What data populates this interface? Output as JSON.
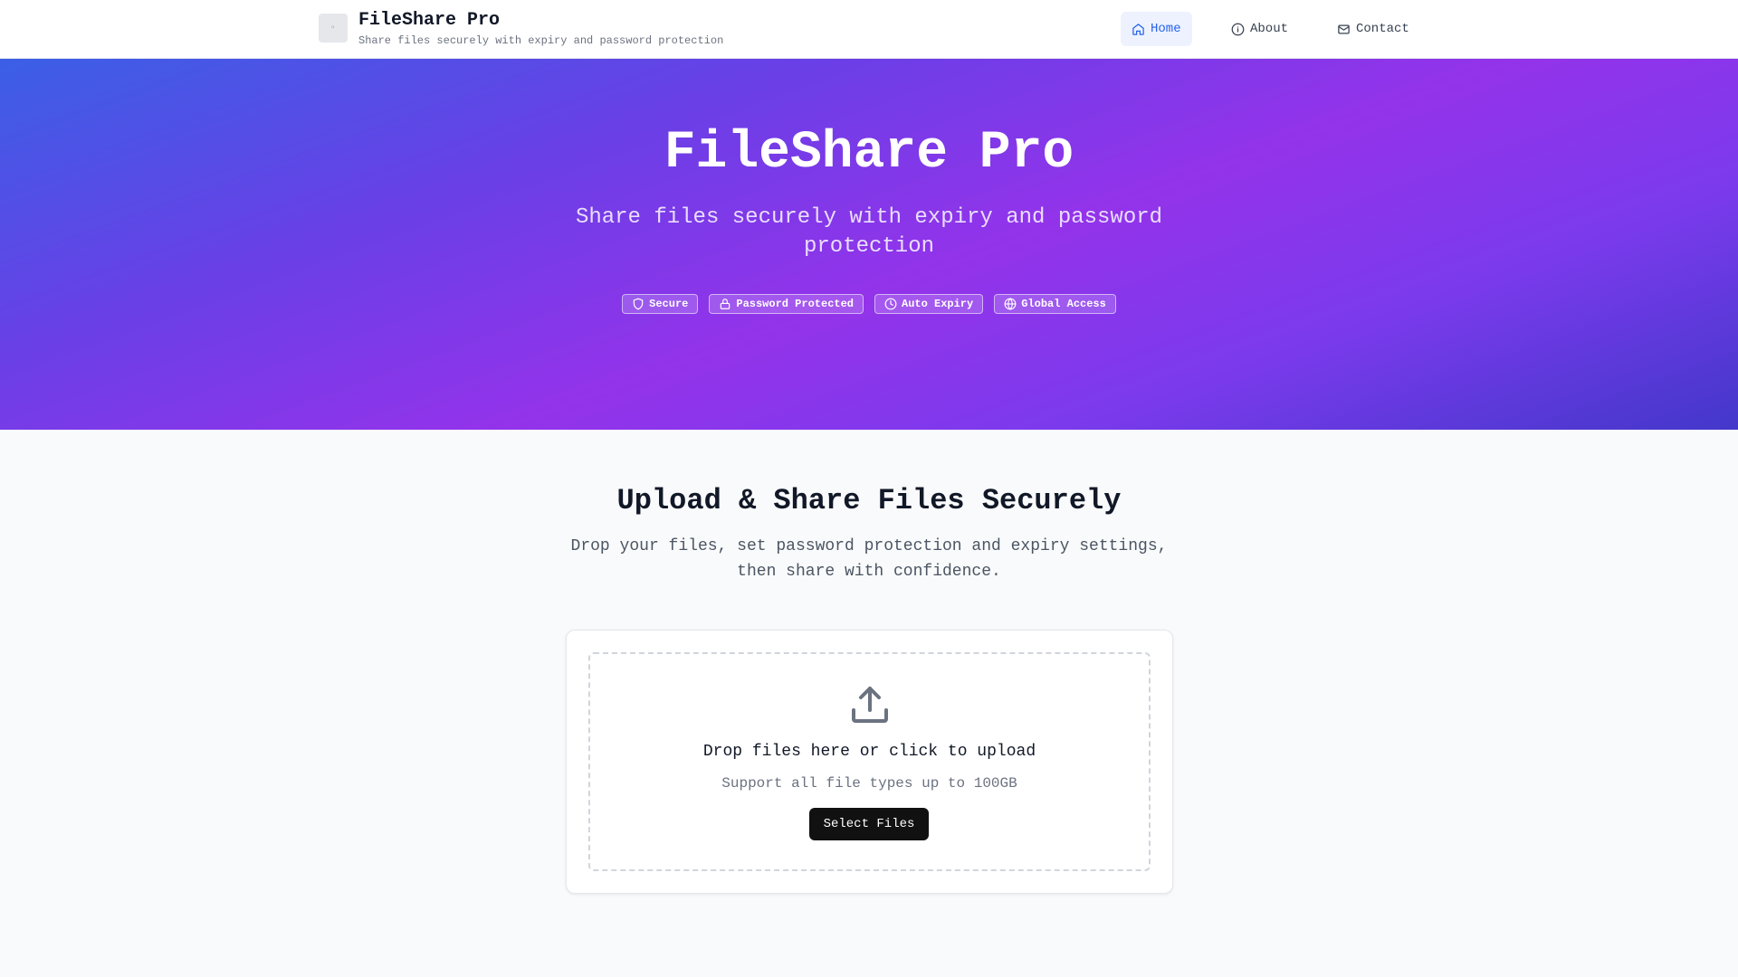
{
  "header": {
    "title": "FileShare Pro",
    "subtitle": "Share files securely with expiry and password protection",
    "nav": [
      {
        "label": "Home",
        "icon": "home-icon",
        "active": true
      },
      {
        "label": "About",
        "icon": "info-icon",
        "active": false
      },
      {
        "label": "Contact",
        "icon": "mail-icon",
        "active": false
      }
    ]
  },
  "hero": {
    "title": "FileShare Pro",
    "subtitle": "Share files securely with expiry and password protection",
    "badges": [
      {
        "label": "Secure",
        "icon": "shield-icon"
      },
      {
        "label": "Password Protected",
        "icon": "lock-icon"
      },
      {
        "label": "Auto Expiry",
        "icon": "clock-icon"
      },
      {
        "label": "Global Access",
        "icon": "globe-icon"
      }
    ]
  },
  "main": {
    "title": "Upload & Share Files Securely",
    "description": "Drop your files, set password protection and expiry settings, then share with confidence.",
    "upload": {
      "icon": "upload-icon",
      "title": "Drop files here or click to upload",
      "subtitle": "Support all file types up to 100GB",
      "button_label": "Select Files"
    }
  },
  "colors": {
    "accent": "#2563eb",
    "hero_gradient_start": "#3b5fe6",
    "hero_gradient_mid": "#9333ea",
    "hero_gradient_end": "#4338ca",
    "button": "#111111"
  }
}
